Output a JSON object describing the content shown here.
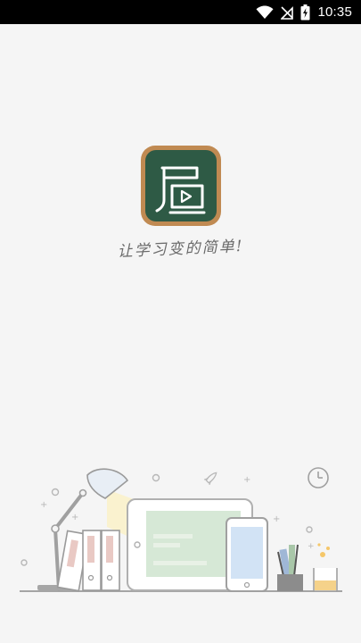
{
  "status_bar": {
    "time": "10:35",
    "icons": [
      "wifi-icon",
      "no-signal-icon",
      "battery-charging-icon"
    ]
  },
  "splash": {
    "slogan": "让学习变的简单!",
    "logo_icon": "app-logo-icon",
    "brand_colors": {
      "board_green": "#2e5a45",
      "frame_brown": "#c08a52"
    }
  }
}
